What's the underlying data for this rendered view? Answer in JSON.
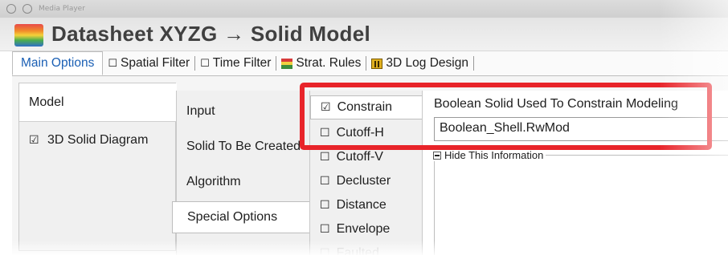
{
  "window": {
    "title": "Media Player"
  },
  "header": {
    "title": "Datasheet XYZG → Solid Model"
  },
  "tabs": [
    {
      "label": "Main Options",
      "active": true,
      "checkbox": ""
    },
    {
      "label": "Spatial Filter",
      "active": false,
      "checkbox": "☐"
    },
    {
      "label": "Time Filter",
      "active": false,
      "checkbox": "☐"
    },
    {
      "label": "Strat. Rules",
      "active": false,
      "icon": "strat-rules-icon"
    },
    {
      "label": "3D Log Design",
      "active": false,
      "icon": "log-design-icon"
    }
  ],
  "column1": {
    "selected": "Model",
    "items": [
      {
        "label": "Model",
        "checkbox": ""
      },
      {
        "label": "3D Solid Diagram",
        "checkbox": "☑"
      }
    ]
  },
  "column2": {
    "selected": "Special Options",
    "items": [
      {
        "label": "Input"
      },
      {
        "label": "Solid To Be Created"
      },
      {
        "label": "Algorithm"
      },
      {
        "label": "Special Options"
      }
    ]
  },
  "column3": {
    "selected": "Constrain",
    "items": [
      {
        "label": "Constrain",
        "checkbox": "☑"
      },
      {
        "label": "Cutoff-H",
        "checkbox": "☐"
      },
      {
        "label": "Cutoff-V",
        "checkbox": "☐"
      },
      {
        "label": "Decluster",
        "checkbox": "☐"
      },
      {
        "label": "Distance",
        "checkbox": "☐"
      },
      {
        "label": "Envelope",
        "checkbox": "☐"
      },
      {
        "label": "Faulted",
        "checkbox": "☐"
      }
    ]
  },
  "panel": {
    "label": "Boolean Solid Used To Constrain Modeling",
    "value": "Boolean_Shell.RwMod",
    "hide_label": "Hide This Information"
  },
  "colors": {
    "highlight": "#e8242a",
    "active_tab": "#1a5fb4"
  }
}
